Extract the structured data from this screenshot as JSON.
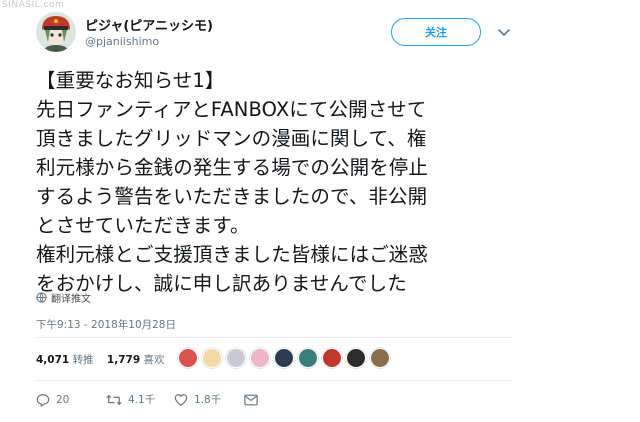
{
  "watermark": "SINASIL.com",
  "user": {
    "display_name": "ピジャ(ピアニッシモ)",
    "handle": "@pjaniishimo"
  },
  "follow_label": "关注",
  "tweet_lines": [
    "【重要なお知らせ1】",
    "先日ファンティアとFANBOXにて公開させて",
    "頂きましたグリッドマンの漫画に関して、権",
    "利元様から金銭の発生する場での公開を停止",
    "するよう警告をいただきましたので、非公開",
    "とさせていただきます。",
    "権利元様とご支援頂きました皆様にはご迷惑",
    "をおかけし、誠に申し訳ありませんでした"
  ],
  "translate_label": "翻译推文",
  "timestamp": "下午9:13 - 2018年10月28日",
  "stats": {
    "retweets_count": "4,071",
    "retweets_label": "转推",
    "likes_count": "1,779",
    "likes_label": "喜欢"
  },
  "actions": {
    "reply_count": "20",
    "retweet_count": "4.1千",
    "like_count": "1.8千"
  },
  "colors": {
    "accent": "#1da1f2",
    "text": "#14171a",
    "muted": "#657786",
    "liker_colors": [
      "#d9534f",
      "#f3d9a4",
      "#c9c9d6",
      "#f0b4c8",
      "#2f3b52",
      "#3a7d7a",
      "#c0392b",
      "#2d2d2d",
      "#8a6d4a"
    ]
  }
}
